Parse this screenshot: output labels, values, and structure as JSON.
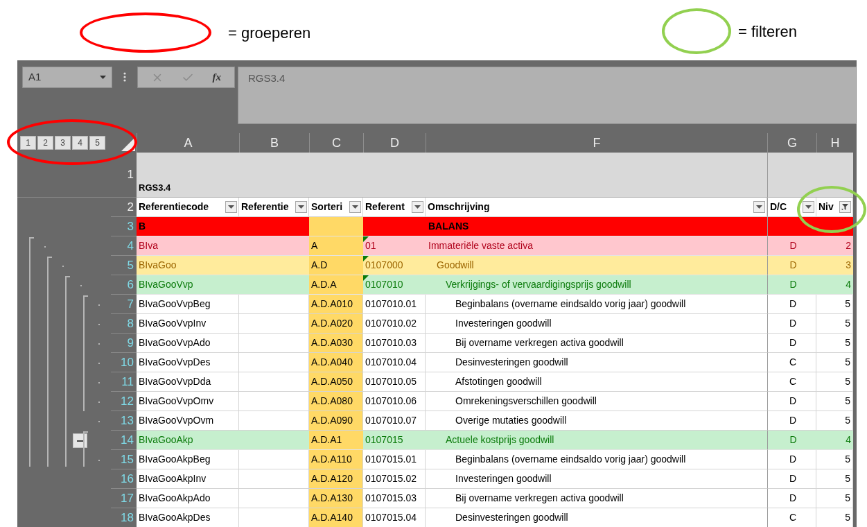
{
  "legend": [
    {
      "label": "= groeperen",
      "color": "#ff0000"
    },
    {
      "label": "= filteren",
      "color": "#92d050"
    }
  ],
  "formula_bar": {
    "name_box": "A1",
    "fx": "fx",
    "formula": "RGS3.4"
  },
  "outline_levels": [
    "1",
    "2",
    "3",
    "4",
    "5"
  ],
  "columns": [
    "A",
    "B",
    "C",
    "D",
    "F",
    "G",
    "H"
  ],
  "title_row": {
    "num": "1",
    "text": "RGS3.4"
  },
  "header_row": {
    "num": "2",
    "headers": [
      {
        "label": "Referentiecode",
        "filtered": false
      },
      {
        "label": "Referentie",
        "filtered": false
      },
      {
        "label": "Sorteri",
        "filtered": false
      },
      {
        "label": "Referent",
        "filtered": false
      },
      {
        "label": "Omschrijving",
        "filtered": false
      },
      {
        "label": "D/C",
        "filtered": false
      },
      {
        "label": "Niv",
        "filtered": true
      }
    ]
  },
  "rows": [
    {
      "num": "3",
      "kind": "red",
      "filtered": true,
      "flag": false,
      "collapse": false,
      "cells": [
        "B",
        "",
        "",
        "",
        "BALANS",
        "",
        ""
      ]
    },
    {
      "num": "4",
      "kind": "pink",
      "filtered": true,
      "flag": true,
      "collapse": false,
      "cells": [
        "BIva",
        "",
        "A",
        "01",
        "Immateriële vaste activa",
        "D",
        "2"
      ]
    },
    {
      "num": "5",
      "kind": "yellow",
      "filtered": true,
      "flag": true,
      "collapse": false,
      "cells": [
        "BIvaGoo",
        "",
        "A.D",
        "0107000",
        "Goodwill",
        "D",
        "3"
      ]
    },
    {
      "num": "6",
      "kind": "green",
      "filtered": true,
      "flag": true,
      "collapse": false,
      "cells": [
        "BIvaGooVvp",
        "",
        "A.D.A",
        "0107010",
        "Verkrijgings- of vervaardigingsprijs goodwill",
        "D",
        "4"
      ]
    },
    {
      "num": "7",
      "kind": "plain",
      "filtered": true,
      "flag": false,
      "collapse": false,
      "cells": [
        "BIvaGooVvpBeg",
        "",
        "A.D.A010",
        "0107010.01",
        "Beginbalans (overname eindsaldo vorig jaar) goodwill",
        "D",
        "5"
      ]
    },
    {
      "num": "8",
      "kind": "plain",
      "filtered": true,
      "flag": false,
      "collapse": false,
      "cells": [
        "BIvaGooVvpInv",
        "",
        "A.D.A020",
        "0107010.02",
        "Investeringen goodwill",
        "D",
        "5"
      ]
    },
    {
      "num": "9",
      "kind": "plain",
      "filtered": true,
      "flag": false,
      "collapse": false,
      "cells": [
        "BIvaGooVvpAdo",
        "",
        "A.D.A030",
        "0107010.03",
        "Bij overname verkregen activa goodwill",
        "D",
        "5"
      ]
    },
    {
      "num": "10",
      "kind": "plain",
      "filtered": true,
      "flag": false,
      "collapse": false,
      "cells": [
        "BIvaGooVvpDes",
        "",
        "A.D.A040",
        "0107010.04",
        "Desinvesteringen goodwill",
        "C",
        "5"
      ]
    },
    {
      "num": "11",
      "kind": "plain",
      "filtered": true,
      "flag": false,
      "collapse": false,
      "cells": [
        "BIvaGooVvpDda",
        "",
        "A.D.A050",
        "0107010.05",
        "Afstotingen goodwill",
        "C",
        "5"
      ]
    },
    {
      "num": "12",
      "kind": "plain",
      "filtered": true,
      "flag": false,
      "collapse": false,
      "cells": [
        "BIvaGooVvpOmv",
        "",
        "A.D.A080",
        "0107010.06",
        "Omrekeningsverschillen goodwill",
        "D",
        "5"
      ]
    },
    {
      "num": "13",
      "kind": "plain",
      "filtered": true,
      "flag": false,
      "collapse": false,
      "cells": [
        "BIvaGooVvpOvm",
        "",
        "A.D.A090",
        "0107010.07",
        "Overige mutaties goodwill",
        "D",
        "5"
      ]
    },
    {
      "num": "14",
      "kind": "green",
      "filtered": true,
      "flag": false,
      "collapse": true,
      "cells": [
        "BIvaGooAkp",
        "",
        "A.D.A1",
        "0107015",
        "Actuele kostprijs goodwill",
        "D",
        "4"
      ]
    },
    {
      "num": "15",
      "kind": "plain",
      "filtered": true,
      "flag": false,
      "collapse": false,
      "cells": [
        "BIvaGooAkpBeg",
        "",
        "A.D.A110",
        "0107015.01",
        "Beginbalans (overname eindsaldo vorig jaar) goodwill",
        "D",
        "5"
      ]
    },
    {
      "num": "16",
      "kind": "plain",
      "filtered": true,
      "flag": false,
      "collapse": false,
      "cells": [
        "BIvaGooAkpInv",
        "",
        "A.D.A120",
        "0107015.02",
        "Investeringen goodwill",
        "D",
        "5"
      ]
    },
    {
      "num": "17",
      "kind": "plain",
      "filtered": true,
      "flag": false,
      "collapse": false,
      "cells": [
        "BIvaGooAkpAdo",
        "",
        "A.D.A130",
        "0107015.03",
        "Bij overname verkregen activa goodwill",
        "D",
        "5"
      ]
    },
    {
      "num": "18",
      "kind": "plain",
      "filtered": true,
      "flag": false,
      "collapse": false,
      "cells": [
        "BIvaGooAkpDes",
        "",
        "A.D.A140",
        "0107015.04",
        "Desinvesteringen goodwill",
        "C",
        "5"
      ]
    }
  ]
}
